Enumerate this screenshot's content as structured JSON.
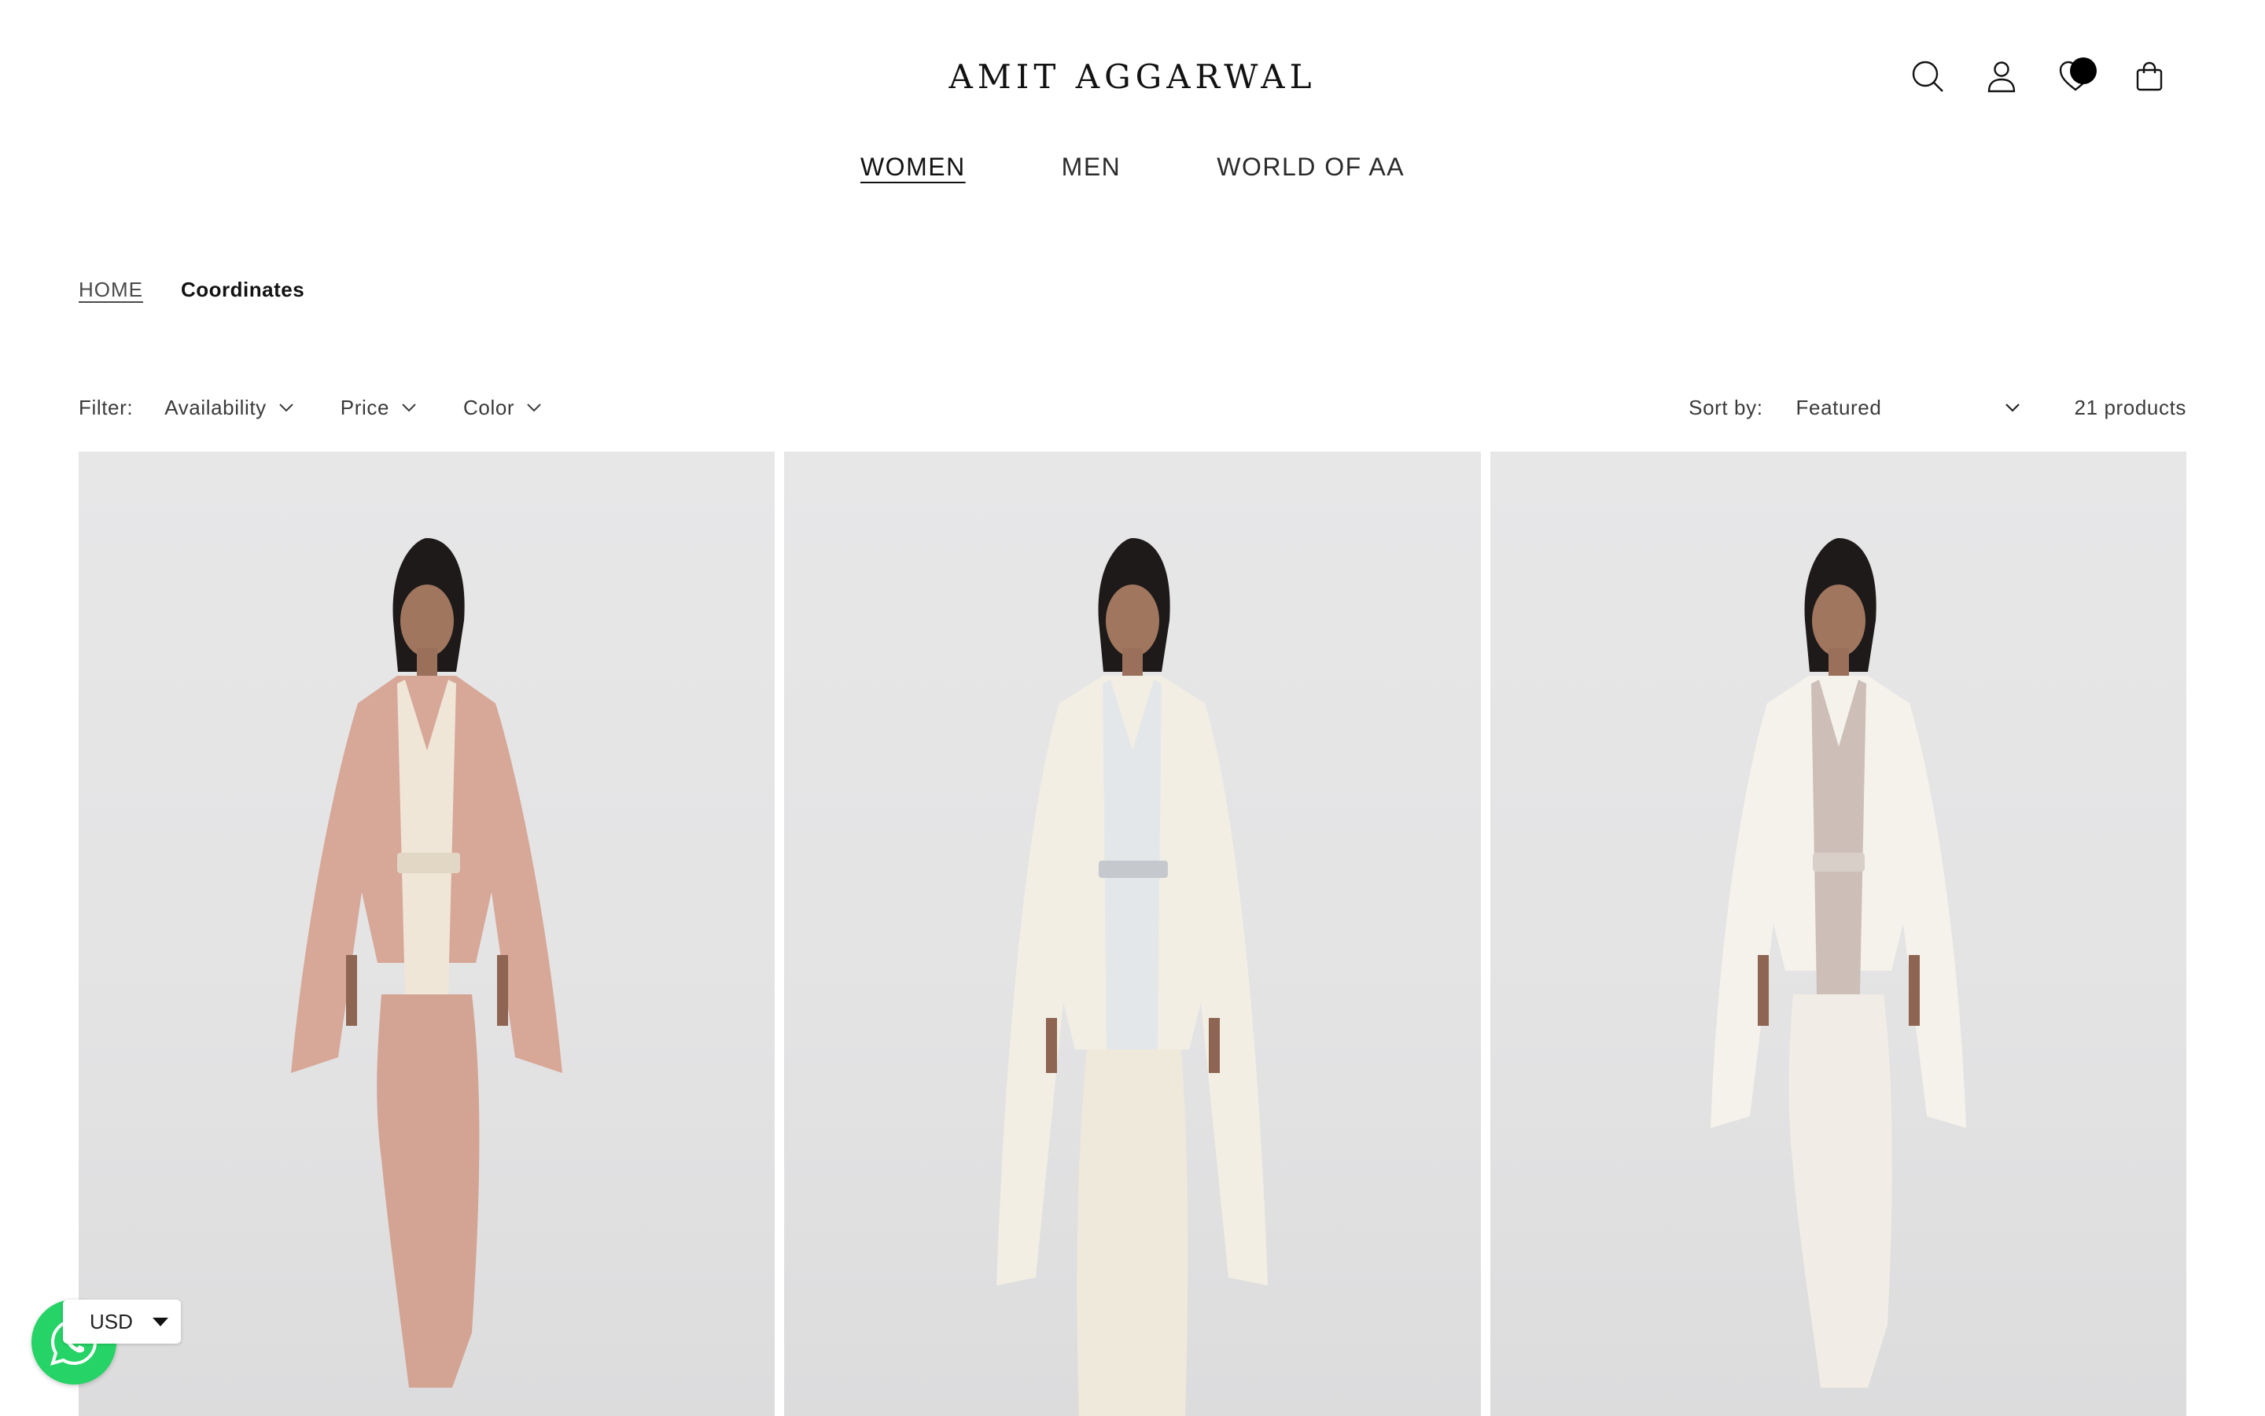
{
  "header": {
    "logo_text": "AMIT AGGARWAL",
    "icons": [
      "search-icon",
      "account-icon",
      "wishlist-icon",
      "cart-icon"
    ]
  },
  "nav": {
    "items": [
      {
        "label": "WOMEN",
        "active": true
      },
      {
        "label": "MEN",
        "active": false
      },
      {
        "label": "WORLD OF AA",
        "active": false
      }
    ]
  },
  "breadcrumb": {
    "home": "HOME",
    "current": "Coordinates"
  },
  "filters": {
    "label": "Filter:",
    "items": [
      "Availability",
      "Price",
      "Color"
    ],
    "sort_label": "Sort by:",
    "sort_value": "Featured",
    "product_count": "21 products"
  },
  "products": [
    {
      "name": "product-1",
      "garment_color": "#d7a797",
      "panel_color": "#efe6d8",
      "belt_color": "#e2d7c5"
    },
    {
      "name": "product-2",
      "garment_color": "#f2eee3",
      "panel_color": "#e4e7ea",
      "belt_color": "#c5c8cc"
    },
    {
      "name": "product-3",
      "garment_color": "#f5f2ec",
      "panel_color": "#cdbfb8",
      "belt_color": "#d8cfc8"
    }
  ],
  "currency": {
    "value": "USD"
  },
  "colors": {
    "accent": "#121212",
    "background": "#ffffff",
    "whatsapp": "#25d366"
  }
}
